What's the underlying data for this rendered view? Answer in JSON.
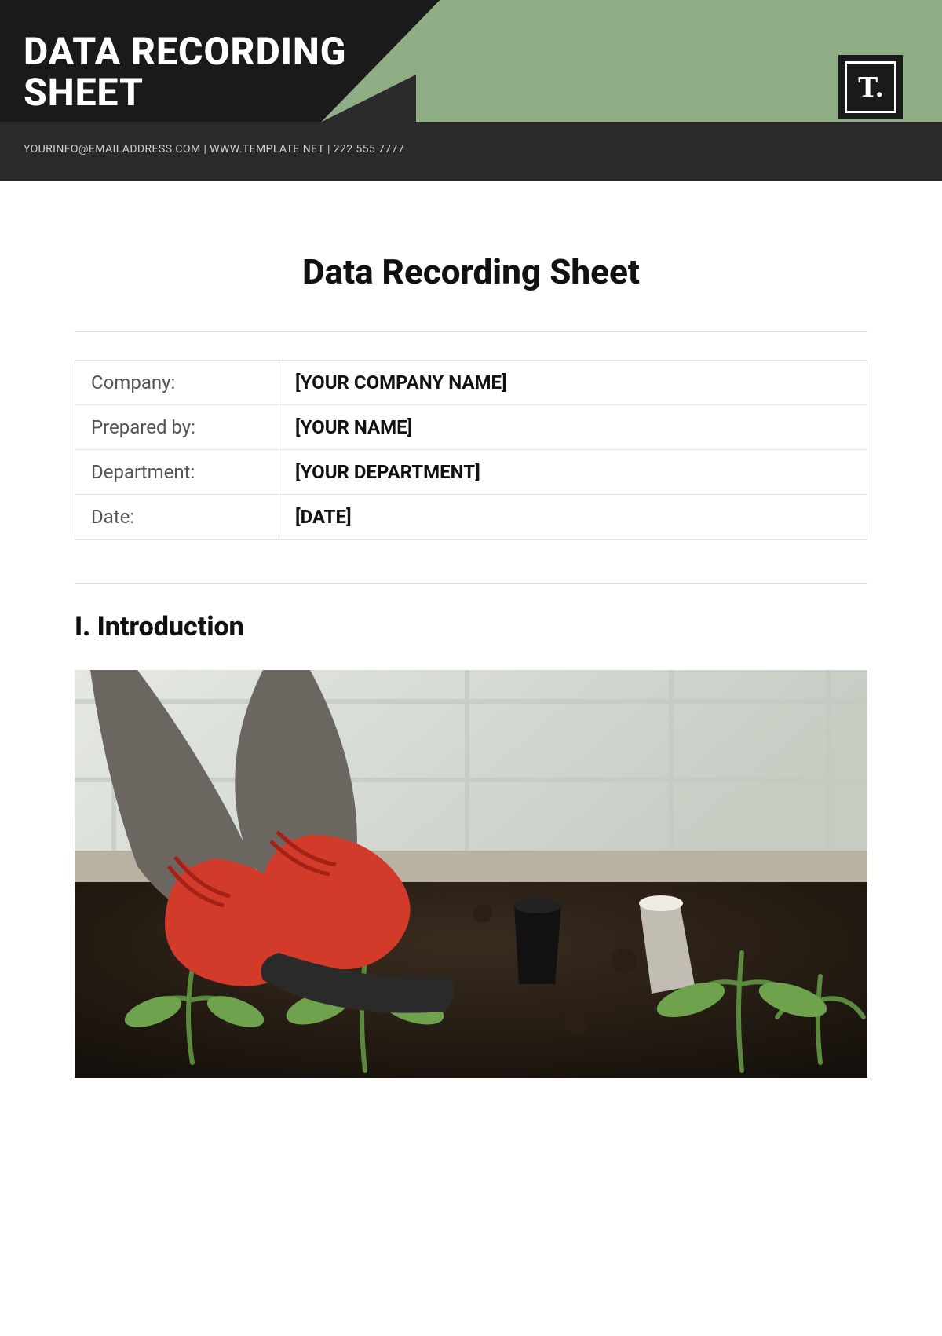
{
  "header": {
    "title_line1": "DATA RECORDING",
    "title_line2": "SHEET",
    "contact": "YOURINFO@EMAILADDRESS.COM | WWW.TEMPLATE.NET | 222 555 7777",
    "logo_text": "T."
  },
  "page": {
    "title": "Data Recording Sheet"
  },
  "meta": {
    "rows": [
      {
        "label": "Company:",
        "value": "[YOUR COMPANY NAME]"
      },
      {
        "label": "Prepared by:",
        "value": "[YOUR NAME]"
      },
      {
        "label": "Department:",
        "value": "[YOUR DEPARTMENT]"
      },
      {
        "label": "Date:",
        "value": "[DATE]"
      }
    ]
  },
  "sections": {
    "intro_heading": "I. Introduction"
  },
  "image": {
    "alt": "Person wearing red gloves planting seedlings in greenhouse soil"
  }
}
